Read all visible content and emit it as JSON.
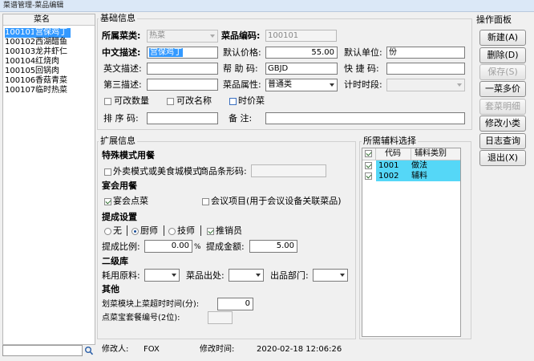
{
  "window": {
    "title": "菜谱管理-菜品编辑"
  },
  "list": {
    "header": "菜名",
    "items": [
      {
        "code": "100101",
        "name": "宫保鸡丁",
        "selected": true
      },
      {
        "code": "100102",
        "name": "西湖醋鱼"
      },
      {
        "code": "100103",
        "name": "龙井虾仁"
      },
      {
        "code": "100104",
        "name": "红烧肉"
      },
      {
        "code": "100105",
        "name": "回锅肉"
      },
      {
        "code": "100106",
        "name": "香菇青菜"
      },
      {
        "code": "100107",
        "name": "临时热菜"
      }
    ],
    "search_icon": "magnifier-icon"
  },
  "basic": {
    "title": "基础信息",
    "category_label": "所属菜类:",
    "category_value": "热菜",
    "code_label": "菜品编码:",
    "code_value": "100101",
    "cn_label": "中文描述:",
    "cn_value": "宫保鸡丁",
    "price_label": "默认价格:",
    "price_value": "55.00",
    "unit_label": "默认单位:",
    "unit_value": "份",
    "en_label": "英文描述:",
    "en_value": "",
    "mnemonic_label": "帮 助 码:",
    "mnemonic_value": "GBJD",
    "quick_label": "快 捷 码:",
    "quick_value": "",
    "third_label": "第三描述:",
    "third_value": "",
    "attr_label": "菜品属性:",
    "attr_value": "普通类",
    "period_label": "计时时段:",
    "period_value": "",
    "variable_qty": "可改数量",
    "variable_name": "可改名称",
    "market_price": "时价菜",
    "order_label": "排 序 码:",
    "order_value": "",
    "note_label": "备    注:",
    "note_value": ""
  },
  "ext": {
    "title": "扩展信息",
    "special_title": "特殊模式用餐",
    "takeout_label": "外卖模式或美食城模式",
    "barcode_label": "商品条形码:",
    "barcode_value": "",
    "banquet_title": "宴会用餐",
    "banquet_label": "宴会点菜",
    "meeting_label": "会议项目(用于会议设备关联菜品)",
    "commission_title": "提成设置",
    "none_label": "无",
    "chef_label": "厨师",
    "tech_label": "技师",
    "sales_label": "推销员",
    "ratio_label": "提成比例:",
    "ratio_value": "0.00",
    "ratio_unit": "%",
    "amount_label": "提成金额:",
    "amount_value": "5.00",
    "stock_title": "二级库",
    "material_label": "耗用原料:",
    "material_value": "",
    "outlet_label": "菜品出处:",
    "outlet_value": "",
    "dept_label": "出品部门:",
    "dept_value": "",
    "other_title": "其他",
    "timeout_label": "划菜模块上菜超时时间(分):",
    "timeout_value": "0",
    "combo_label": "点菜宝套餐编号(2位):",
    "combo_value": ""
  },
  "aux": {
    "title": "所需辅料选择",
    "col_code": "代码",
    "col_type": "辅料类别",
    "rows": [
      {
        "code": "1001",
        "type": "做法",
        "checked": true
      },
      {
        "code": "1002",
        "type": "辅料",
        "checked": true
      }
    ]
  },
  "ops": {
    "title": "操作面板",
    "new": "新建(A)",
    "delete": "删除(D)",
    "save": "保存(S)",
    "multi_price": "一菜多价",
    "combo_detail": "套菜明细",
    "edit_sub": "修改小类",
    "log": "日志查询",
    "exit": "退出(X)"
  },
  "footer": {
    "modifier_label": "修改人:",
    "modifier_value": "FOX",
    "time_label": "修改时间:",
    "time_value": "2020-02-18 12:06:26"
  },
  "colors": {
    "selection": "#3399ff",
    "check_highlight": "#55d7f7"
  }
}
